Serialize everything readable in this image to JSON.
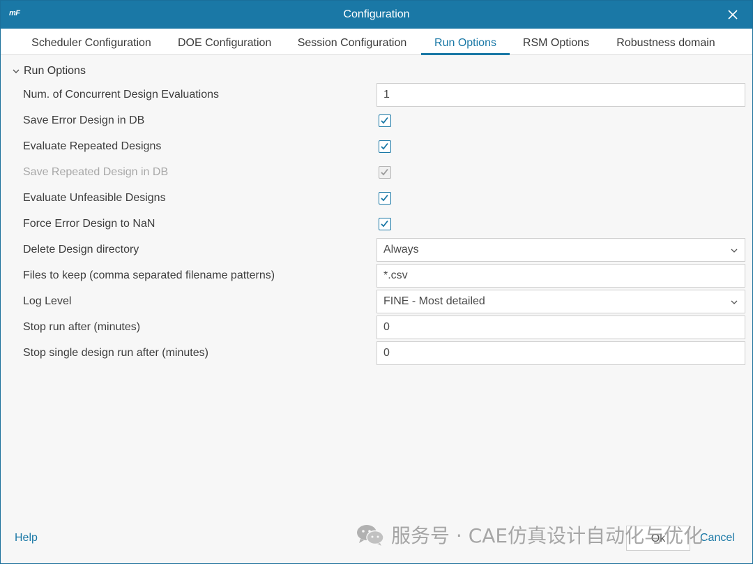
{
  "window": {
    "logo": "mF",
    "title": "Configuration"
  },
  "tabs": [
    {
      "label": "Scheduler Configuration",
      "active": false
    },
    {
      "label": "DOE Configuration",
      "active": false
    },
    {
      "label": "Session Configuration",
      "active": false
    },
    {
      "label": "Run Options",
      "active": true
    },
    {
      "label": "RSM Options",
      "active": false
    },
    {
      "label": "Robustness domain",
      "active": false
    }
  ],
  "section": {
    "title": "Run Options",
    "expanded": true
  },
  "options": {
    "concurrent_evaluations": {
      "label": "Num. of Concurrent Design Evaluations",
      "value": "1"
    },
    "save_error_design": {
      "label": "Save Error Design in DB",
      "checked": true
    },
    "evaluate_repeated": {
      "label": "Evaluate Repeated Designs",
      "checked": true
    },
    "save_repeated": {
      "label": "Save Repeated Design in DB",
      "checked": true,
      "disabled": true
    },
    "evaluate_unfeasible": {
      "label": "Evaluate Unfeasible Designs",
      "checked": true
    },
    "force_error_nan": {
      "label": "Force Error Design to NaN",
      "checked": true
    },
    "delete_directory": {
      "label": "Delete Design directory",
      "value": "Always"
    },
    "files_to_keep": {
      "label": "Files to keep (comma separated filename patterns)",
      "value": "*.csv"
    },
    "log_level": {
      "label": "Log Level",
      "value": "FINE - Most detailed"
    },
    "stop_run_after": {
      "label": "Stop run after (minutes)",
      "value": "0"
    },
    "stop_single_after": {
      "label": "Stop single design run after (minutes)",
      "value": "0"
    }
  },
  "footer": {
    "help": "Help",
    "ok": "Ok",
    "cancel": "Cancel"
  },
  "watermark": "服务号 · CAE仿真设计自动化与优化",
  "colors": {
    "accent": "#1a78a6",
    "background": "#f7f7f7",
    "disabled_text": "#a8a8a8"
  }
}
